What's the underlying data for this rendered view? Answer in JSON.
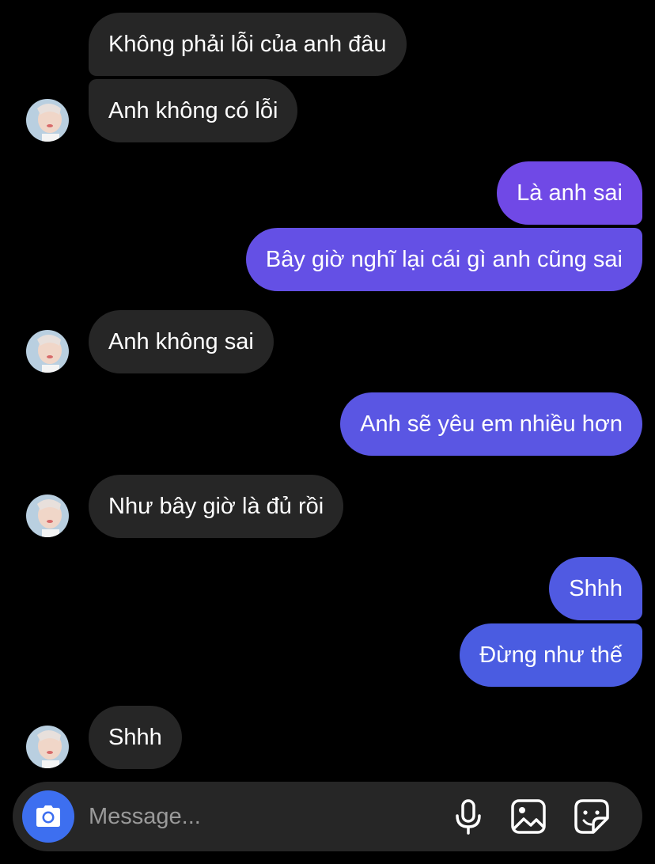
{
  "colors": {
    "background": "#000000",
    "incoming_bubble": "#262626",
    "outgoing_gradient_top": "#7a46e8",
    "outgoing_gradient_bottom": "#3f5ee0",
    "composer": "#262626",
    "camera_button": "#3d6ff0"
  },
  "messages": [
    {
      "direction": "incoming",
      "text": "Không phải lỗi của anh đâu"
    },
    {
      "direction": "incoming",
      "text": "Anh không có lỗi",
      "avatar": true
    },
    {
      "direction": "outgoing",
      "text": "Là anh sai"
    },
    {
      "direction": "outgoing",
      "text": "Bây giờ nghĩ lại cái gì anh cũng sai"
    },
    {
      "direction": "incoming",
      "text": "Anh không sai",
      "avatar": true
    },
    {
      "direction": "outgoing",
      "text": "Anh sẽ yêu em nhiều hơn"
    },
    {
      "direction": "incoming",
      "text": "Như bây giờ là đủ rồi",
      "avatar": true
    },
    {
      "direction": "outgoing",
      "text": "Shhh"
    },
    {
      "direction": "outgoing",
      "text": "Đừng như thế"
    },
    {
      "direction": "incoming",
      "text": "Shhh",
      "avatar": true
    }
  ],
  "composer": {
    "placeholder": "Message...",
    "camera_icon": "camera-icon",
    "tools": [
      "microphone-icon",
      "image-icon",
      "sticker-icon"
    ]
  }
}
